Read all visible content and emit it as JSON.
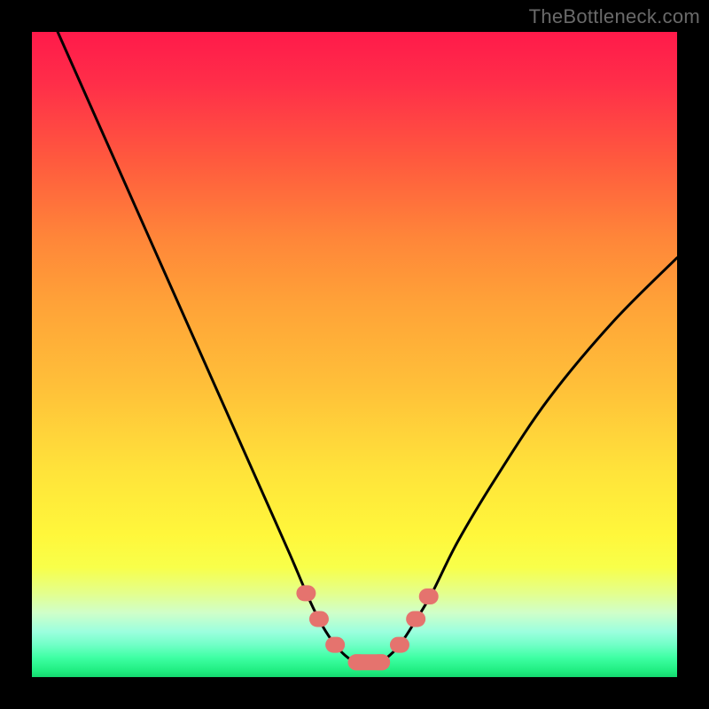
{
  "attribution": "TheBottleneck.com",
  "chart_data": {
    "type": "line",
    "title": "",
    "xlabel": "",
    "ylabel": "",
    "xlim": [
      0,
      100
    ],
    "ylim": [
      0,
      100
    ],
    "series": [
      {
        "name": "bottleneck-curve",
        "x": [
          4,
          8,
          12,
          16,
          20,
          24,
          28,
          32,
          36,
          40,
          43,
          45,
          47,
          49,
          51,
          53,
          55,
          57,
          59,
          62,
          66,
          72,
          80,
          90,
          100
        ],
        "y": [
          100,
          91,
          82,
          73,
          64,
          55,
          46,
          37,
          28,
          19,
          12,
          8,
          5,
          3,
          2,
          2,
          3,
          5,
          8,
          13,
          21,
          31,
          43,
          55,
          65
        ]
      }
    ],
    "markers": {
      "name": "highlight-points",
      "points": [
        {
          "x": 42.5,
          "y": 13
        },
        {
          "x": 44.5,
          "y": 9
        },
        {
          "x": 47,
          "y": 5
        },
        {
          "x": 50.5,
          "y": 2.3
        },
        {
          "x": 54,
          "y": 2.3
        },
        {
          "x": 57,
          "y": 5
        },
        {
          "x": 59.5,
          "y": 9
        },
        {
          "x": 61.5,
          "y": 12.5
        }
      ]
    },
    "background_gradient": {
      "top": "#ff1a4a",
      "mid": "#ffe33a",
      "bottom": "#14d86f"
    }
  }
}
